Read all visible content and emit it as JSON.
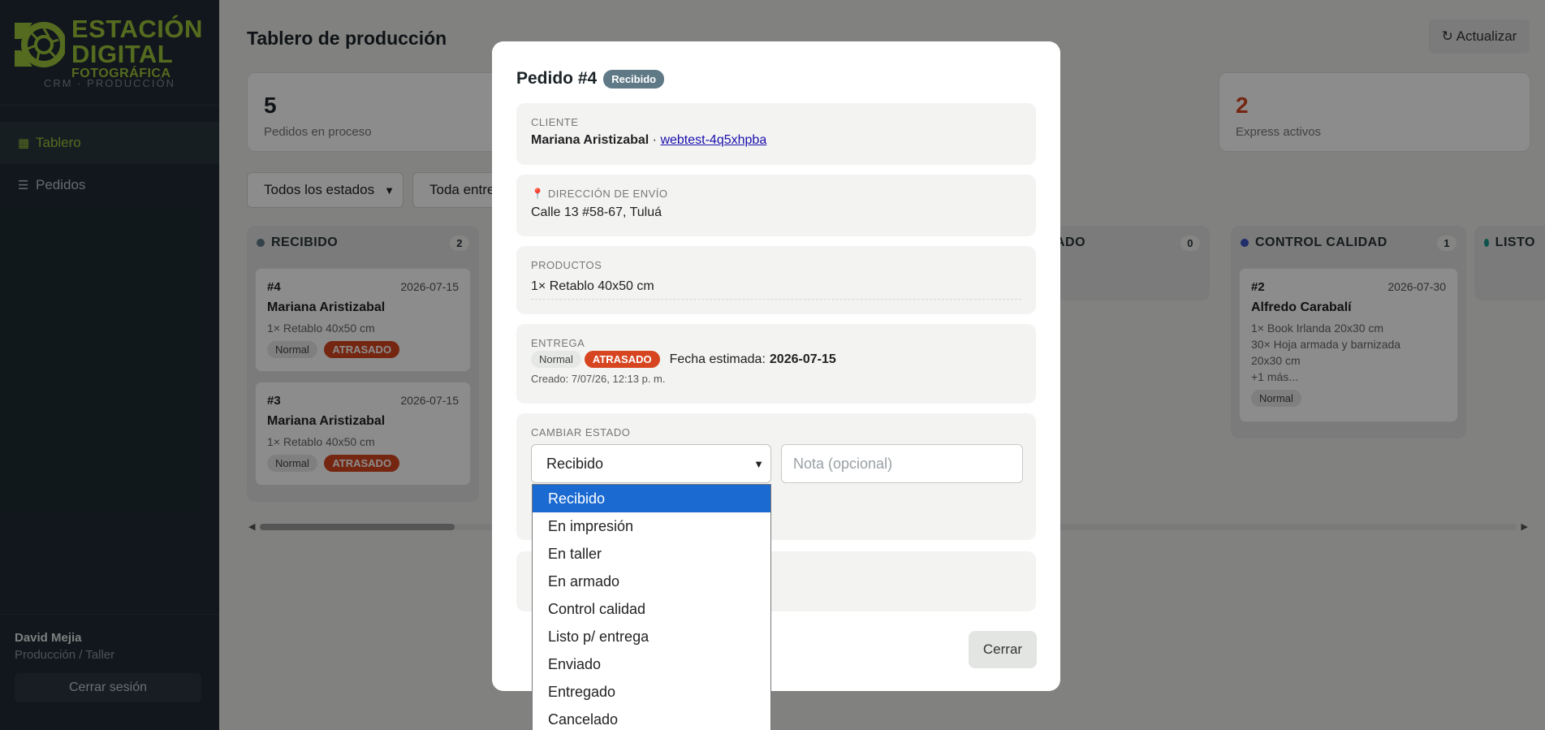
{
  "brand": {
    "line1": "ESTACIÓN",
    "line2": "DIGITAL",
    "line3": "FOTOGRÁFICA",
    "subtitle": "CRM · PRODUCCIÓN",
    "color": "#9bc33a"
  },
  "sidebar": {
    "items": [
      {
        "icon": "▦",
        "label": "Tablero",
        "active": true
      },
      {
        "icon": "☰",
        "label": "Pedidos",
        "active": false
      }
    ],
    "user": {
      "name": "David Mejia",
      "role": "Producción / Taller"
    },
    "logout_label": "Cerrar sesión"
  },
  "header": {
    "title": "Tablero de producción",
    "refresh_label": "↻ Actualizar"
  },
  "stats": [
    {
      "value": "5",
      "label": "Pedidos en proceso"
    },
    {
      "value": "2",
      "label": "Express activos"
    }
  ],
  "filters": {
    "status": "Todos los estados",
    "delivery": "Toda entre"
  },
  "columns": [
    {
      "title": "RECIBIDO",
      "count": "2",
      "dot_color": "#607987",
      "cards": [
        {
          "id": "#4",
          "date": "2026-07-15",
          "customer": "Mariana Aristizabal",
          "products": [
            "1× Retablo 40x50 cm"
          ],
          "tags": [
            "Normal",
            "ATRASADO"
          ]
        },
        {
          "id": "#3",
          "date": "2026-07-15",
          "customer": "Mariana Aristizabal",
          "products": [
            "1× Retablo 40x50 cm"
          ],
          "tags": [
            "Normal",
            "ATRASADO"
          ]
        }
      ]
    },
    {
      "title": "ADO",
      "count": "0"
    },
    {
      "title": "CONTROL CALIDAD",
      "count": "1",
      "dot_color": "#3b55c4",
      "cards": [
        {
          "id": "#2",
          "date": "2026-07-30",
          "customer": "Alfredo Carabalí",
          "products": [
            "1× Book Irlanda 20x30 cm",
            "30× Hoja armada y barnizada",
            "20x30 cm",
            "+1 más..."
          ],
          "tags": [
            "Normal"
          ]
        }
      ]
    },
    {
      "title": "LISTO",
      "dot_color": "#1a9a8a"
    }
  ],
  "modal": {
    "title": "Pedido #4",
    "status_badge": "Recibido",
    "client": {
      "caption": "CLIENTE",
      "name": "Mariana Aristizabal",
      "separator": " · ",
      "link": "webtest-4q5xhpba"
    },
    "address": {
      "icon": "📍",
      "caption": "DIRECCIÓN DE ENVÍO",
      "value": "Calle 13 #58-67, Tuluá"
    },
    "products": {
      "caption": "PRODUCTOS",
      "items": [
        "1× Retablo 40x50 cm"
      ]
    },
    "delivery": {
      "caption": "ENTREGA",
      "tags": [
        "Normal",
        "ATRASADO"
      ],
      "estimate_label": "Fecha estimada:",
      "estimate_value": "2026-07-15",
      "created": "Creado: 7/07/26, 12:13 p. m."
    },
    "change_status": {
      "caption": "CAMBIAR ESTADO",
      "selected": "Recibido",
      "note_placeholder": "Nota (opcional)",
      "options": [
        "Recibido",
        "En impresión",
        "En taller",
        "En armado",
        "Control calidad",
        "Listo p/ entrega",
        "Enviado",
        "Entregado",
        "Cancelado"
      ]
    },
    "close_label": "Cerrar"
  },
  "colors": {
    "late": "#d64520",
    "accent": "#9bc33a",
    "selected_option": "#1a6ad1"
  }
}
